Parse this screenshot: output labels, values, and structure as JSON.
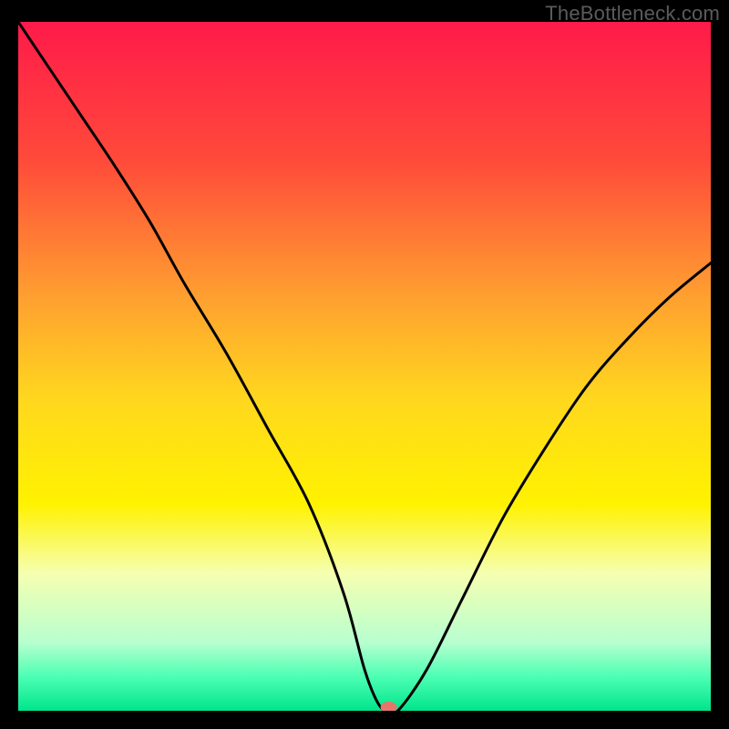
{
  "watermark": "TheBottleneck.com",
  "chart_data": {
    "type": "line",
    "title": "",
    "xlabel": "",
    "ylabel": "",
    "xlim": [
      0,
      100
    ],
    "ylim": [
      0,
      100
    ],
    "grid": false,
    "gradient_stops": [
      {
        "offset": 0.0,
        "color": "#ff1a4a"
      },
      {
        "offset": 0.2,
        "color": "#ff4a3a"
      },
      {
        "offset": 0.4,
        "color": "#ffa030"
      },
      {
        "offset": 0.55,
        "color": "#ffd81e"
      },
      {
        "offset": 0.7,
        "color": "#fff200"
      },
      {
        "offset": 0.8,
        "color": "#f6ffb0"
      },
      {
        "offset": 0.9,
        "color": "#b8ffcf"
      },
      {
        "offset": 0.95,
        "color": "#4dffb4"
      },
      {
        "offset": 1.0,
        "color": "#00e58c"
      }
    ],
    "series": [
      {
        "name": "bottleneck-curve",
        "x": [
          0,
          8,
          14,
          19,
          24,
          30,
          36,
          42,
          47,
          50,
          52,
          53.5,
          55,
          59,
          64,
          70,
          76,
          82,
          88,
          94,
          100
        ],
        "y": [
          100,
          88,
          79,
          71,
          62,
          52,
          41,
          30,
          17,
          6,
          1,
          0,
          0.2,
          6,
          16,
          28,
          38,
          47,
          54,
          60,
          65
        ]
      }
    ],
    "marker": {
      "x": 53.5,
      "y": 0,
      "color": "#e4766c"
    }
  }
}
